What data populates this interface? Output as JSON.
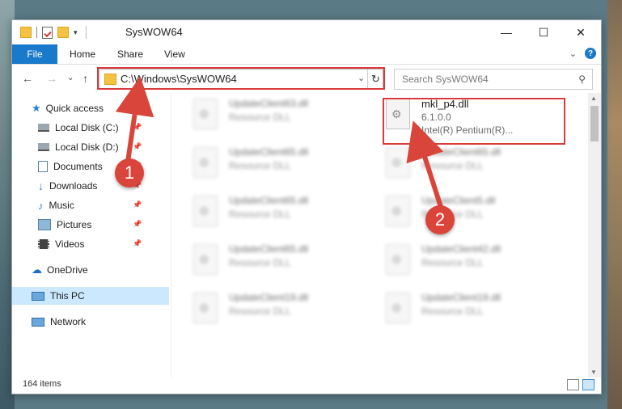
{
  "window": {
    "title": "SysWOW64"
  },
  "ribbon": {
    "tabs": [
      "File",
      "Home",
      "Share",
      "View"
    ]
  },
  "address": {
    "path": "C:\\Windows\\SysWOW64"
  },
  "search": {
    "placeholder": "Search SysWOW64"
  },
  "nav": {
    "items": [
      {
        "label": "Quick access",
        "icon": "star-icon"
      },
      {
        "label": "Local Disk (C:)",
        "icon": "drive-icon"
      },
      {
        "label": "Local Disk (D:)",
        "icon": "drive-icon"
      },
      {
        "label": "Documents",
        "icon": "documents-icon"
      },
      {
        "label": "Downloads",
        "icon": "downloads-icon"
      },
      {
        "label": "Music",
        "icon": "music-icon"
      },
      {
        "label": "Pictures",
        "icon": "pictures-icon"
      },
      {
        "label": "Videos",
        "icon": "videos-icon"
      },
      {
        "label": "OneDrive",
        "icon": "cloud-icon"
      },
      {
        "label": "This PC",
        "icon": "pc-icon"
      },
      {
        "label": "Network",
        "icon": "network-icon"
      }
    ]
  },
  "files": {
    "left": [
      {
        "name": "UpdateClient63.dll",
        "sub": "Resource DLL"
      },
      {
        "name": "UpdateClient65.dll",
        "sub": "Resource DLL"
      },
      {
        "name": "UpdateClient65.dll",
        "sub": "Resource DLL"
      },
      {
        "name": "UpdateClient65.dll",
        "sub": "Resource DLL"
      },
      {
        "name": "UpdateClient19.dll",
        "sub": "Resource DLL"
      }
    ],
    "right": [
      {
        "name": "mkl_p4.dll",
        "sub": "6.1.0.0",
        "sub2": "Intel(R) Pentium(R)..."
      },
      {
        "name": "UpdateClient65.dll",
        "sub": "Resource DLL"
      },
      {
        "name": "UpdateClient5.dll",
        "sub": "Resource DLL"
      },
      {
        "name": "UpdateClient42.dll",
        "sub": "Resource DLL"
      },
      {
        "name": "UpdateClient19.dll",
        "sub": "Resource DLL"
      }
    ]
  },
  "status": {
    "count": "164 items"
  },
  "annotations": {
    "step1": "1",
    "step2": "2"
  },
  "colors": {
    "accent": "#1979ca",
    "highlight": "#d93a3a",
    "selection": "#cce8ff"
  }
}
